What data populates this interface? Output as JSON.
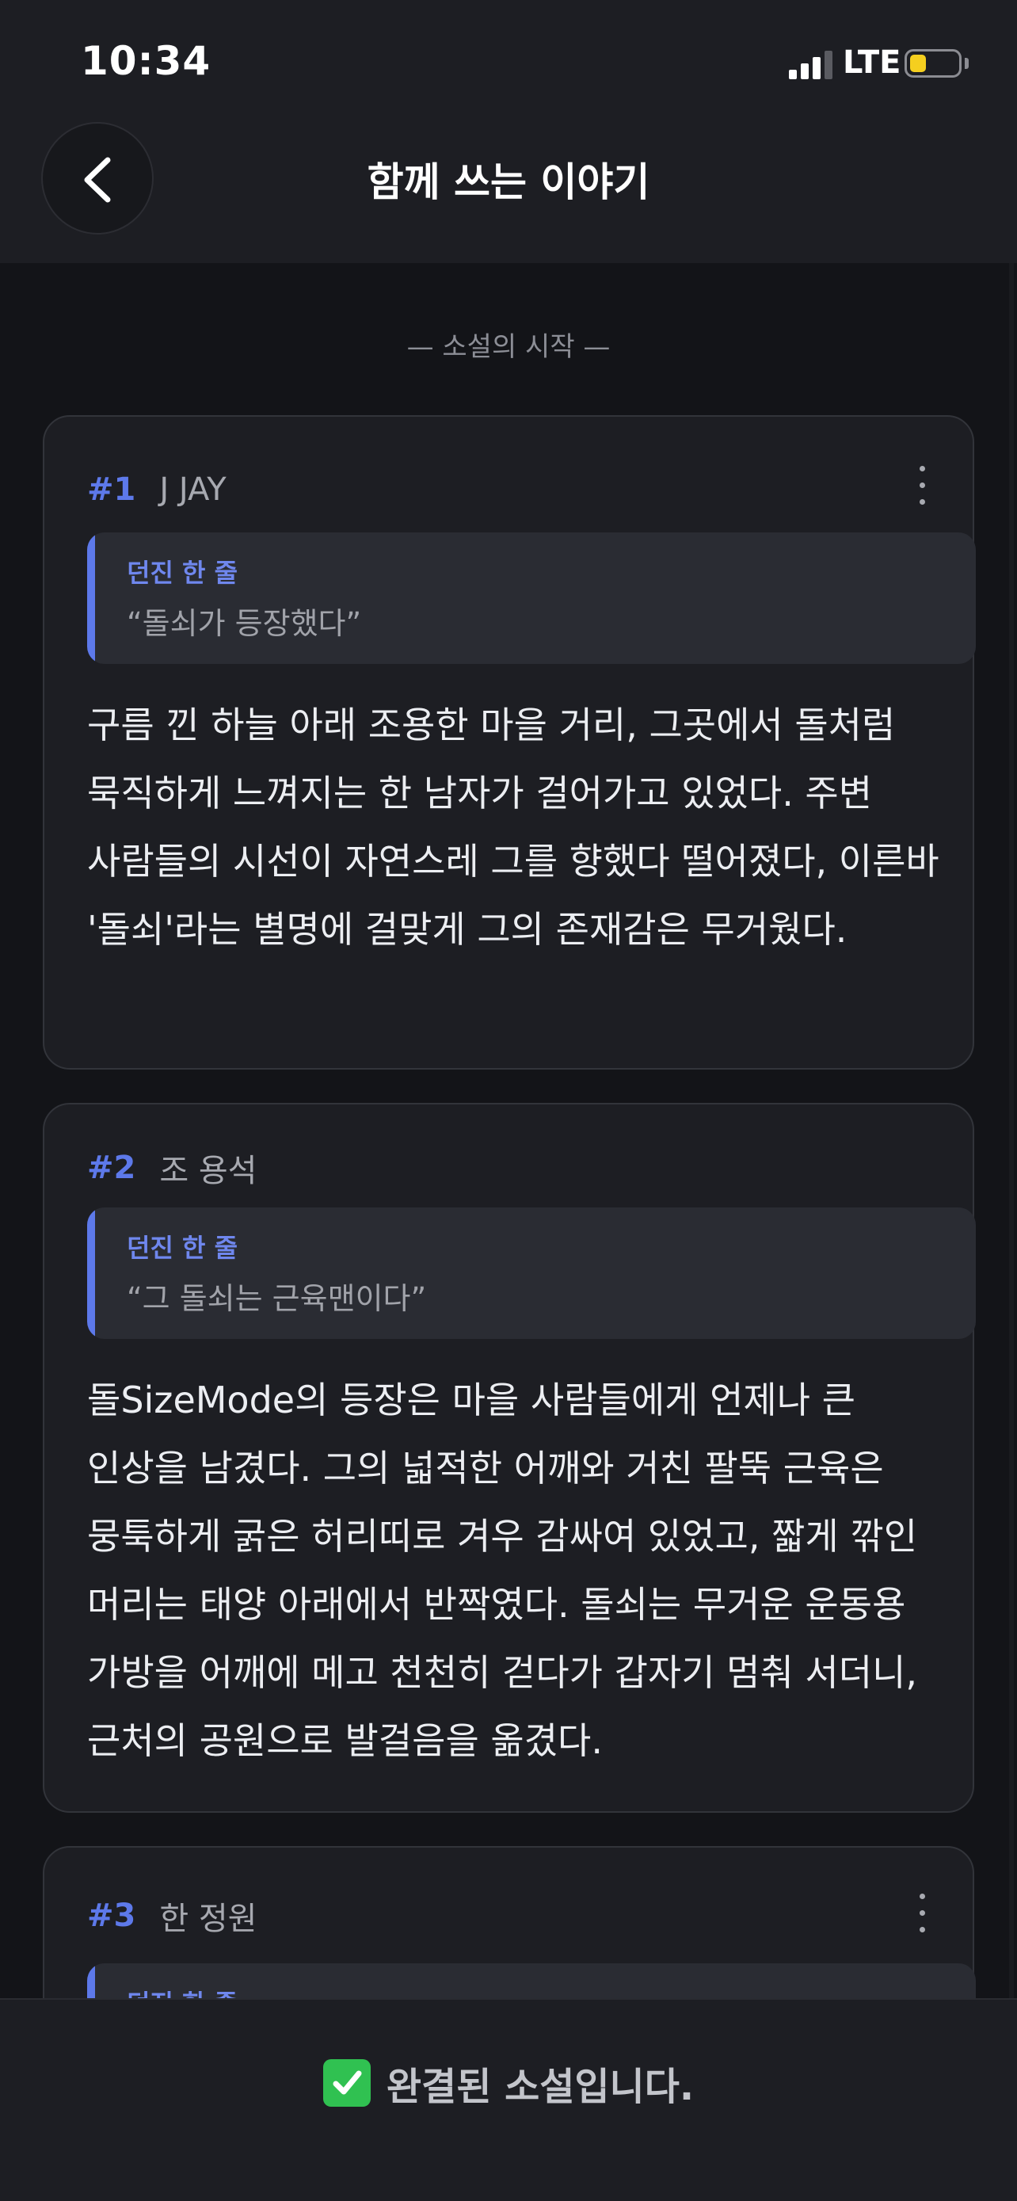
{
  "status_bar": {
    "time": "10:34",
    "network": "LTE"
  },
  "header": {
    "title": "함께 쓰는 이야기"
  },
  "section_label": "— 소설의 시작 —",
  "cards": [
    {
      "num": "#1",
      "author": "J JAY",
      "quote_label": "던진 한 줄",
      "quote": "“돌쇠가 등장했다”",
      "body": "구름 낀 하늘 아래 조용한 마을 거리, 그곳에서 돌처럼 묵직하게 느껴지는 한 남자가 걸어가고 있었다. 주변 사람들의 시선이 자연스레 그를 향했다 떨어졌다, 이른바 '돌쇠'라는 별명에 걸맞게 그의 존재감은 무거웠다."
    },
    {
      "num": "#2",
      "author": "조 용석",
      "quote_label": "던진 한 줄",
      "quote": "“그 돌쇠는 근육맨이다”",
      "body": "돌SizeMode의 등장은 마을 사람들에게 언제나 큰 인상을 남겼다. 그의 넓적한 어깨와 거친 팔뚝 근육은 뭉툭하게 굵은 허리띠로 겨우 감싸여 있었고, 짧게 깎인 머리는 태양 아래에서 반짝였다. 돌쇠는 무거운 운동용 가방을 어깨에 메고 천천히 걷다가 갑자기 멈춰 서더니, 근처의 공원으로 발걸음을 옮겼다."
    },
    {
      "num": "#3",
      "author": "한 정원",
      "quote_label": "던진 한 줄"
    }
  ],
  "footer": {
    "completed_text": "완결된 소설입니다.",
    "check_icon": "check-mark-icon"
  }
}
